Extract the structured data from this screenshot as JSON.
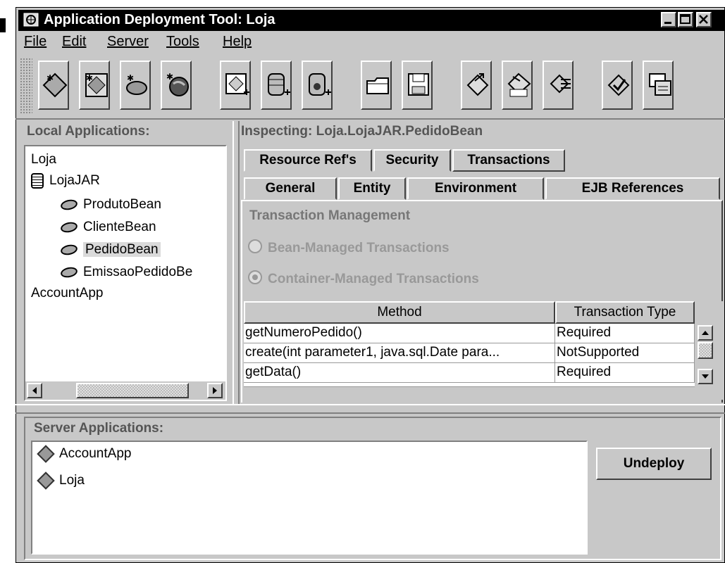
{
  "window": {
    "title": "Application Deployment Tool: Loja"
  },
  "menu": [
    "File",
    "Edit",
    "Server",
    "Tools",
    "Help"
  ],
  "toolbar_icons": [
    "new-application-icon",
    "new-ejb-icon",
    "new-web-component-icon",
    "new-client-icon",
    "add-file-icon",
    "add-database-icon",
    "add-database-alt-icon",
    "open-icon",
    "save-icon",
    "deploy-icon",
    "update-icon",
    "refresh-icon",
    "verify-icon",
    "undeploy-icon"
  ],
  "local_apps": {
    "label": "Local Applications:",
    "items": [
      "Loja",
      "LojaJAR",
      "ProdutoBean",
      "ClienteBean",
      "PedidoBean",
      "EmissaoPedidoBe",
      "AccountApp"
    ]
  },
  "inspector": {
    "heading": "Inspecting: Loja.LojaJAR.PedidoBean",
    "tabs_row1": [
      "Resource Ref's",
      "Security",
      "Transactions"
    ],
    "tabs_row2": [
      "General",
      "Entity",
      "Environment",
      "EJB References"
    ],
    "section_title": "Transaction Management",
    "radio_bean": "Bean-Managed Transactions",
    "radio_container": "Container-Managed Transactions",
    "table": {
      "headers": [
        "Method",
        "Transaction Type"
      ],
      "rows": [
        [
          "getNumeroPedido()",
          "Required"
        ],
        [
          "create(int parameter1, java.sql.Date para...",
          "NotSupported"
        ],
        [
          "getData()",
          "Required"
        ]
      ]
    }
  },
  "server_apps": {
    "label": "Server Applications:",
    "items": [
      "AccountApp",
      "Loja"
    ],
    "undeploy_label": "Undeploy"
  }
}
